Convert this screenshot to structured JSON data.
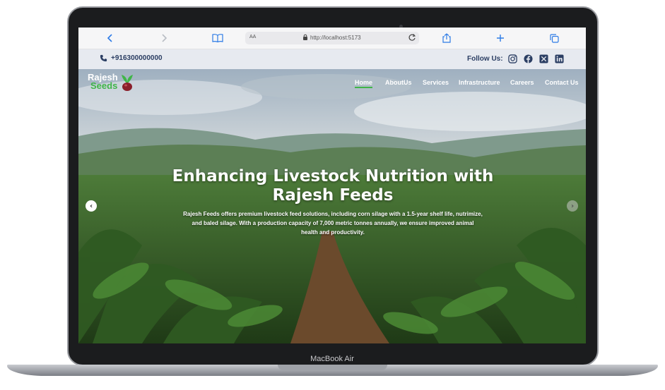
{
  "device": {
    "model_label": "MacBook Air"
  },
  "browser": {
    "aa_label": "AA",
    "url": "http://localhost:5173"
  },
  "topbar": {
    "phone": "+916300000000",
    "follow_label": "Follow Us:"
  },
  "site": {
    "logo_line1": "Rajesh",
    "logo_line2": "Seeds",
    "nav": [
      {
        "label": "Home",
        "active": true
      },
      {
        "label": "AboutUs"
      },
      {
        "label": "Services"
      },
      {
        "label": "Infrastructure"
      },
      {
        "label": "Careers"
      },
      {
        "label": "Contact Us"
      }
    ],
    "hero": {
      "title_line1": "Enhancing Livestock Nutrition with",
      "title_line2": "Rajesh Feeds",
      "subtitle_line1": "Rajesh Feeds offers premium livestock feed solutions, including corn silage with a 1.5-year shelf life, nutrimize,",
      "subtitle_line2": "and baled silage. With a production capacity of 7,000 metric tonnes annually, we ensure improved animal",
      "subtitle_line3": "health and productivity.",
      "prev_symbol": "‹",
      "next_symbol": "›"
    }
  },
  "colors": {
    "accent_green": "#3fb548",
    "topbar_bg": "#e7eaf0",
    "link_text": "#2b3e63",
    "safari_blue": "#2d7be6"
  }
}
